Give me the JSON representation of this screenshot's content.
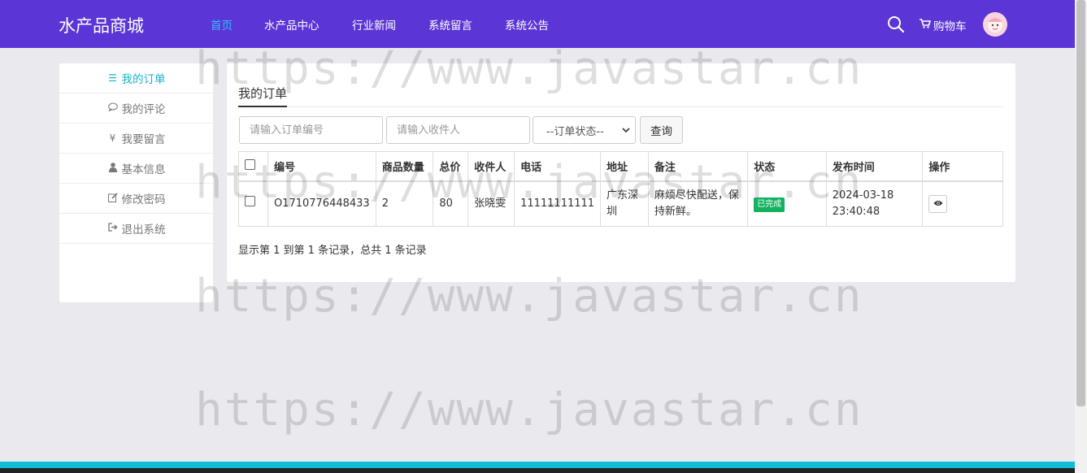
{
  "brand": "水产品商城",
  "nav": {
    "items": [
      {
        "label": "首页",
        "active": true
      },
      {
        "label": "水产品中心",
        "active": false
      },
      {
        "label": "行业新闻",
        "active": false
      },
      {
        "label": "系统留言",
        "active": false
      },
      {
        "label": "系统公告",
        "active": false
      }
    ],
    "cart_label": "购物车"
  },
  "sidebar": {
    "items": [
      {
        "label": "我的订单",
        "icon": "list-icon",
        "active": true
      },
      {
        "label": "我的评论",
        "icon": "comment-icon",
        "active": false
      },
      {
        "label": "我要留言",
        "icon": "yen-icon",
        "active": false
      },
      {
        "label": "基本信息",
        "icon": "user-icon",
        "active": false
      },
      {
        "label": "修改密码",
        "icon": "edit-icon",
        "active": false
      },
      {
        "label": "退出系统",
        "icon": "sign-out-icon",
        "active": false
      }
    ]
  },
  "panel": {
    "title": "我的订单",
    "filters": {
      "order_no_placeholder": "请输入订单编号",
      "receiver_placeholder": "请输入收件人",
      "status_selected": "--订单状态--",
      "query_label": "查询"
    },
    "table": {
      "headers": [
        "编号",
        "商品数量",
        "总价",
        "收件人",
        "电话",
        "地址",
        "备注",
        "状态",
        "发布时间",
        "操作"
      ],
      "rows": [
        {
          "id": "O1710776448433",
          "qty": "2",
          "total": "80",
          "receiver": "张晓雯",
          "phone": "11111111111",
          "address": "广东深圳",
          "remark": "麻烦尽快配送，保持新鲜。",
          "status": "已完成",
          "time": "2024-03-18 23:40:48"
        }
      ]
    },
    "summary": "显示第 1 到第 1 条记录，总共 1 条记录"
  },
  "watermark": "https://www.javastar.cn",
  "colors": {
    "navbar": "#5b35d5",
    "nav_active": "#2fc1ff",
    "sidebar_active": "#16b1c9",
    "badge_done": "#13b260",
    "footer_bar": "#10bcd8"
  }
}
